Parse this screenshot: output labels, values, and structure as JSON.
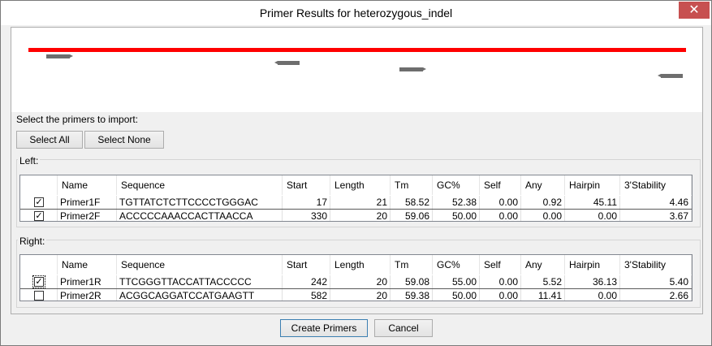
{
  "window": {
    "title": "Primer Results for heterozygous_indel",
    "close_glyph": "✕"
  },
  "instructions": "Select the primers to import:",
  "buttons": {
    "select_all": "Select All",
    "select_none": "Select None",
    "create": "Create Primers",
    "cancel": "Cancel"
  },
  "left": {
    "label": "Left:",
    "columns": [
      "Name",
      "Sequence",
      "Start",
      "Length",
      "Tm",
      "GC%",
      "Self",
      "Any",
      "Hairpin",
      "3'Stability"
    ],
    "rows": [
      {
        "checked": true,
        "name": "Primer1F",
        "sequence": "TGTTATCTCTTCCCCTGGGAC",
        "start": "17",
        "length": "21",
        "tm": "58.52",
        "gc": "52.38",
        "self": "0.00",
        "any": "0.92",
        "hairpin": "45.11",
        "stability": "4.46"
      },
      {
        "checked": true,
        "name": "Primer2F",
        "sequence": "ACCCCCAAACCACTTAACCA",
        "start": "330",
        "length": "20",
        "tm": "59.06",
        "gc": "50.00",
        "self": "0.00",
        "any": "0.00",
        "hairpin": "0.00",
        "stability": "3.67"
      }
    ]
  },
  "right": {
    "label": "Right:",
    "columns": [
      "Name",
      "Sequence",
      "Start",
      "Length",
      "Tm",
      "GC%",
      "Self",
      "Any",
      "Hairpin",
      "3'Stability"
    ],
    "rows": [
      {
        "checked": true,
        "name": "Primer1R",
        "sequence": "TTCGGGTTACCATTACCCCC",
        "start": "242",
        "length": "20",
        "tm": "59.08",
        "gc": "55.00",
        "self": "0.00",
        "any": "5.52",
        "hairpin": "36.13",
        "stability": "5.40"
      },
      {
        "checked": false,
        "name": "Primer2R",
        "sequence": "ACGGCAGGATCCATGAAGTT",
        "start": "582",
        "length": "20",
        "tm": "59.38",
        "gc": "50.00",
        "self": "0.00",
        "any": "11.41",
        "hairpin": "0.00",
        "stability": "2.66"
      }
    ]
  },
  "colors": {
    "sequence_bar": "#ff0000",
    "primer_mark": "#6e6e6e",
    "close_button": "#c75050"
  }
}
